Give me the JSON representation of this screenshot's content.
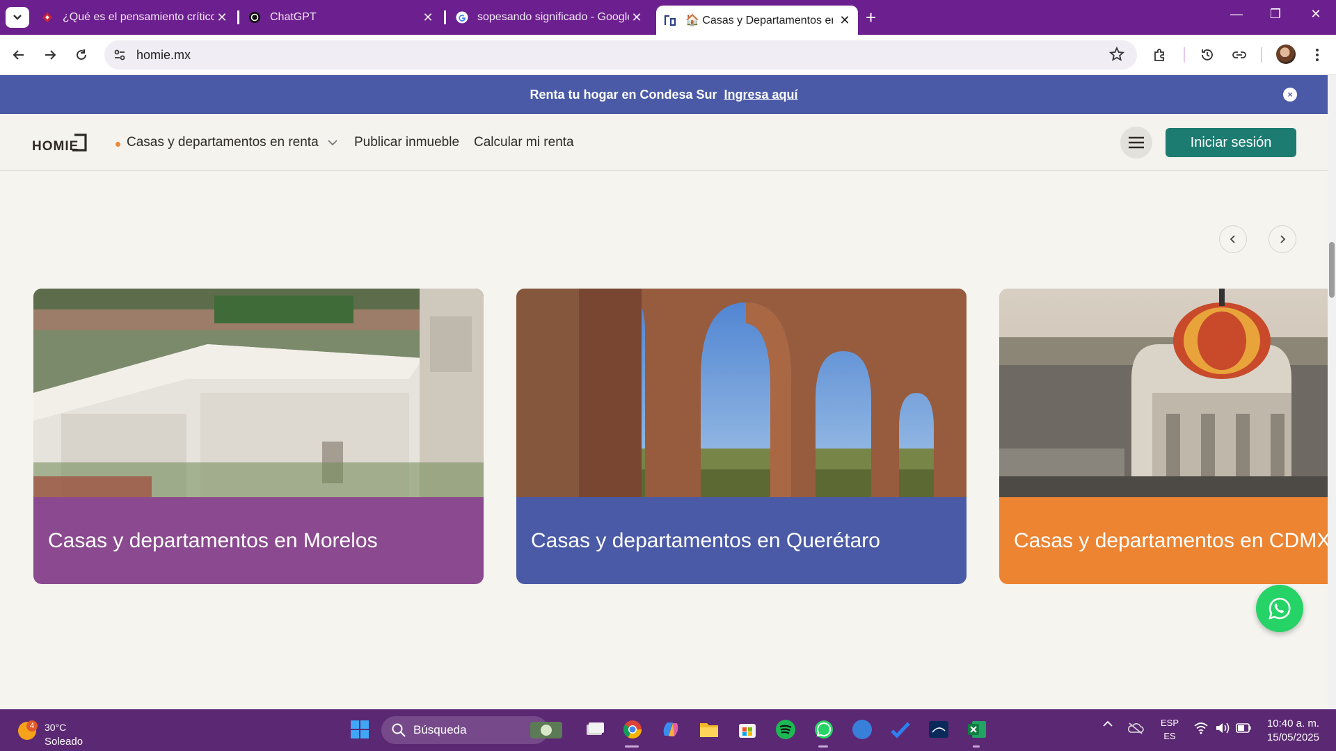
{
  "browser": {
    "tabs": [
      {
        "title": "¿Qué es el pensamiento crítico",
        "favicon": "red-diamond-icon"
      },
      {
        "title": "ChatGPT",
        "favicon": "openai-icon"
      },
      {
        "title": "sopesando significado - Google",
        "favicon": "google-icon"
      },
      {
        "title": "🏠 Casas y Departamentos en Renta",
        "favicon": "homie-icon",
        "active": true
      }
    ],
    "url": "homie.mx",
    "accent_color": "#6c1f8e"
  },
  "site": {
    "promo": {
      "text": "Renta tu hogar en Condesa Sur",
      "link": "Ingresa aquí",
      "close": "×"
    },
    "logo": "HOMIE",
    "nav": {
      "rentals": "Casas y departamentos en renta",
      "publish": "Publicar inmueble",
      "calculate": "Calcular mi renta",
      "login": "Iniciar sesión"
    },
    "cards": [
      {
        "title": "Casas y departamentos en Morelos",
        "color": "#8b4a8f"
      },
      {
        "title": "Casas y departamentos en Querétaro",
        "color": "#4b5aa6"
      },
      {
        "title": "Casas y departamentos en CDMX",
        "color": "#ec8432"
      }
    ]
  },
  "taskbar": {
    "weather": {
      "temp": "30°C",
      "condition": "Soleado",
      "badge": "4"
    },
    "search_placeholder": "Búsqueda",
    "lang_top": "ESP",
    "lang_bottom": "ES",
    "time": "10:40 a. m.",
    "date": "15/05/2025"
  }
}
